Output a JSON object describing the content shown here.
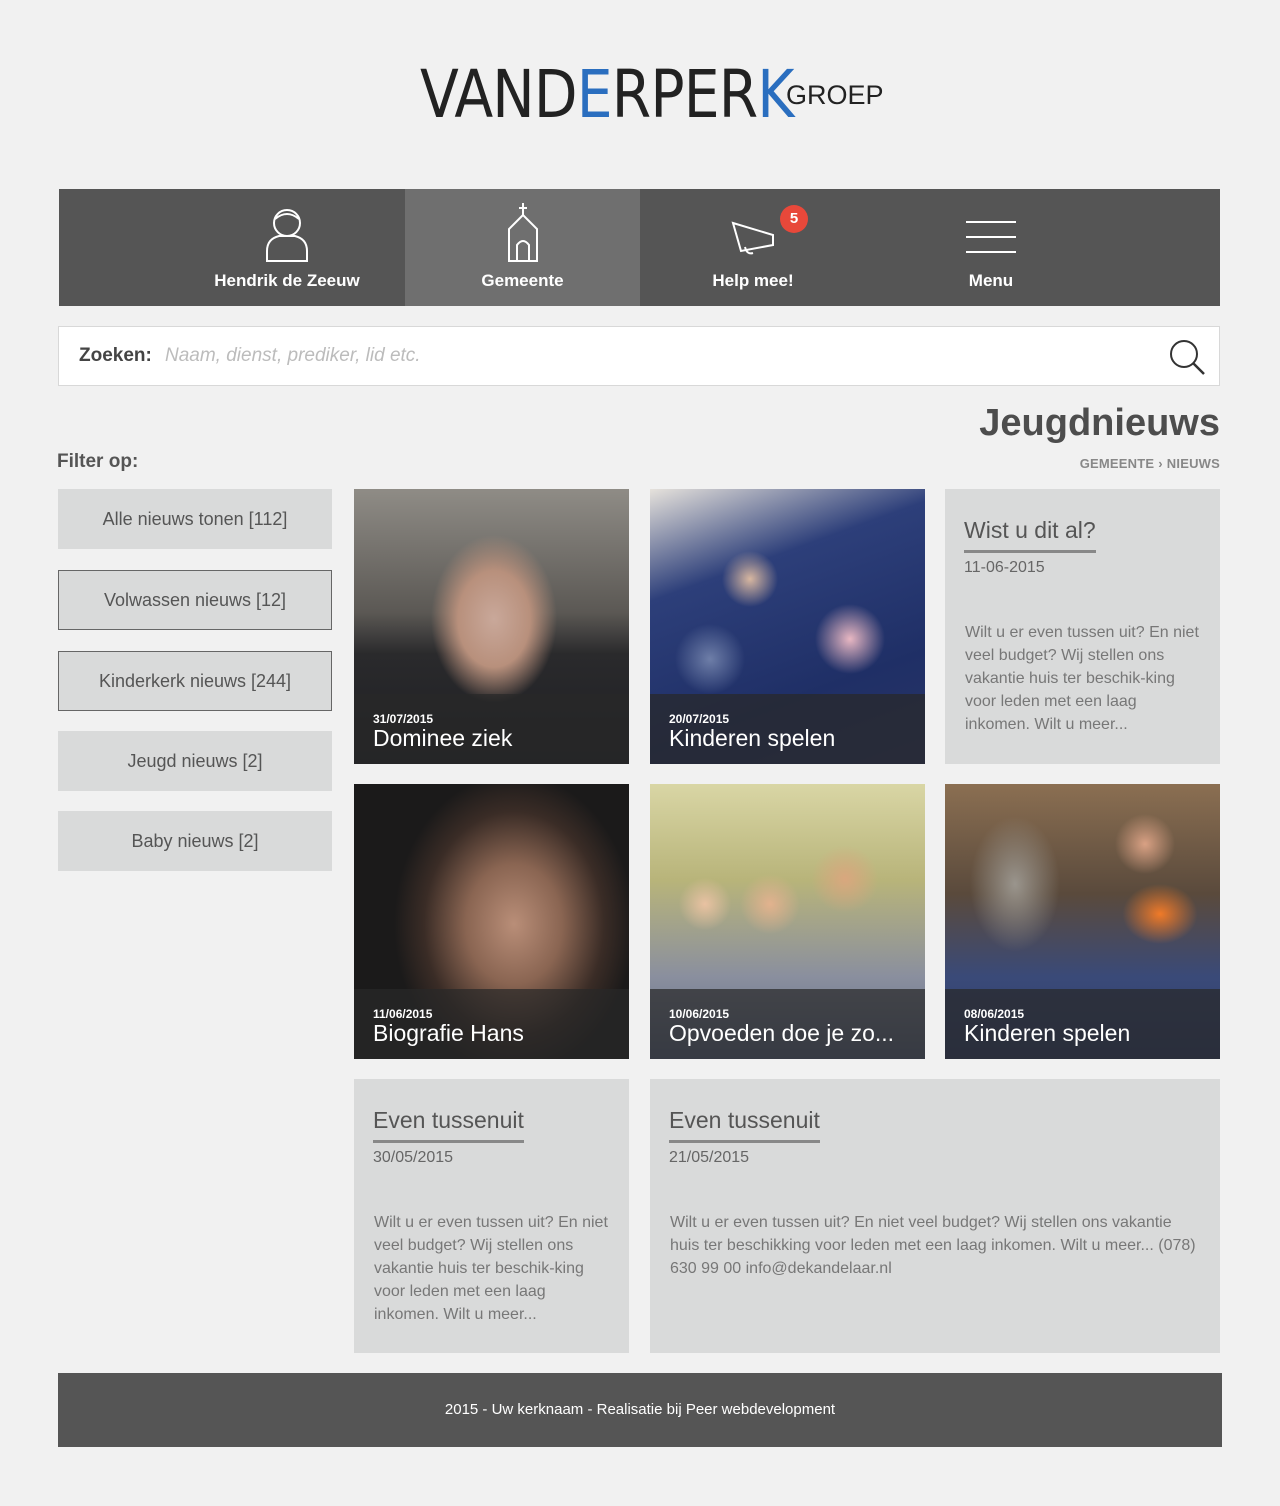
{
  "logo": {
    "main_a": "VAND",
    "main_accent": "E",
    "main_b": "RPER",
    "main_accent2": "K",
    "sub": "GROEP"
  },
  "nav": {
    "items": [
      {
        "label": "Hendrik de Zeeuw",
        "icon": "user-icon"
      },
      {
        "label": "Gemeente",
        "icon": "church-icon",
        "active": true
      },
      {
        "label": "Help mee!",
        "icon": "megaphone-icon",
        "badge": "5"
      },
      {
        "label": "Menu",
        "icon": "hamburger-menu-icon"
      }
    ]
  },
  "search": {
    "label": "Zoeken:",
    "placeholder": "Naam, dienst, prediker, lid etc.",
    "value": ""
  },
  "page": {
    "title": "Jeugdnieuws",
    "breadcrumb": [
      "GEMEENTE",
      "NIEUWS"
    ],
    "breadcrumb_sep": "›"
  },
  "filter": {
    "title": "Filter op:",
    "options": [
      "Alle nieuws tonen [112]",
      "Volwassen nieuws [12]",
      "Kinderkerk nieuws [244]",
      "Jeugd nieuws [2]",
      "Baby nieuws [2]"
    ]
  },
  "news": [
    {
      "date": "31/07/2015",
      "title": "Dominee ziek"
    },
    {
      "date": "20/07/2015",
      "title": "Kinderen spelen"
    },
    {
      "date": "11/06/2015",
      "title": "Biografie Hans"
    },
    {
      "date": "10/06/2015",
      "title": "Opvoeden doe je zo..."
    },
    {
      "date": "08/06/2015",
      "title": "Kinderen spelen"
    }
  ],
  "text_cards": [
    {
      "title": "Wist u dit al?",
      "date": "11-06-2015",
      "body": "Wilt u er even tussen uit? En niet veel budget? Wij stellen ons vakantie huis ter beschik-king voor leden met een laag inkomen. Wilt u meer..."
    },
    {
      "title": "Even tussenuit",
      "date": "30/05/2015",
      "body": "Wilt u er even tussen uit? En niet veel budget? Wij stellen ons vakantie huis ter beschik-king voor leden met een laag inkomen. Wilt u meer..."
    },
    {
      "title": "Even tussenuit",
      "date": "21/05/2015",
      "body": "Wilt u er even tussen uit? En niet veel budget? Wij stellen ons vakantie huis ter beschikking voor leden met een laag inkomen. Wilt u meer... (078) 630 99 00 info@dekandelaar.nl"
    }
  ],
  "footer": {
    "text": "2015 - Uw kerknaam - Realisatie bij Peer webdevelopment"
  },
  "colors": {
    "nav_bg": "#555555",
    "nav_active": "#6f6f6f",
    "badge": "#e8483a",
    "logo_accent": "#2a6ebf",
    "card_bg": "#d9dada"
  }
}
